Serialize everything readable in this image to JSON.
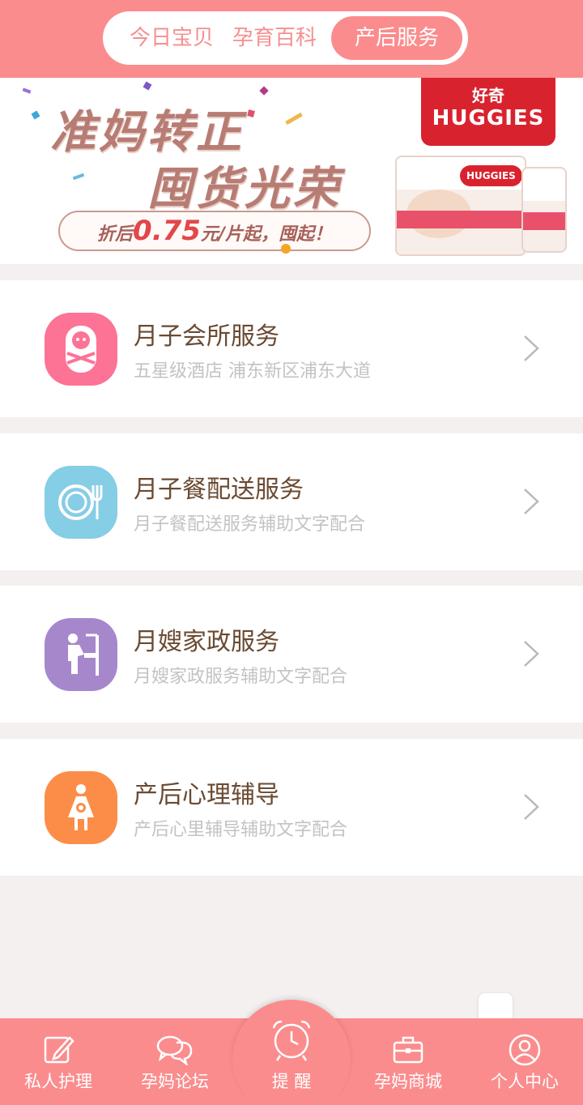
{
  "header": {
    "tabs": [
      {
        "label": "今日宝贝"
      },
      {
        "label": "孕育百科"
      },
      {
        "label": "产后服务"
      }
    ]
  },
  "banner": {
    "headline1": "准妈转正",
    "headline2": "囤货光荣",
    "price_prefix": "折后",
    "price_value": "0.75",
    "price_suffix": "元/片起，囤起！",
    "brand_cn": "好奇",
    "brand_en": "HUGGIES"
  },
  "services": [
    {
      "title": "月子会所服务",
      "subtitle": "五星级酒店 浦东新区浦东大道",
      "icon": "swaddled-baby-icon",
      "color": "#fc7396"
    },
    {
      "title": "月子餐配送服务",
      "subtitle": "月子餐配送服务辅助文字配合",
      "icon": "plate-fork-icon",
      "color": "#86cde6"
    },
    {
      "title": "月嫂家政服务",
      "subtitle": "月嫂家政服务辅助文字配合",
      "icon": "nanny-changing-icon",
      "color": "#a787cc"
    },
    {
      "title": "产后心理辅导",
      "subtitle": "产后心里辅导辅助文字配合",
      "icon": "mother-icon",
      "color": "#fc8d48"
    }
  ],
  "nav": {
    "items": [
      {
        "label": "私人护理",
        "icon": "pencil-note-icon"
      },
      {
        "label": "孕妈论坛",
        "icon": "chat-bubbles-icon"
      },
      {
        "label": "提  醒",
        "icon": "alarm-clock-icon"
      },
      {
        "label": "孕妈商城",
        "icon": "briefcase-icon"
      },
      {
        "label": "个人中心",
        "icon": "user-circle-icon"
      }
    ]
  },
  "colors": {
    "accent": "#fb8c8d",
    "page_bg": "#f4f0ef",
    "title_text": "#6a4a32",
    "subtitle_text": "#c3c3c3"
  }
}
